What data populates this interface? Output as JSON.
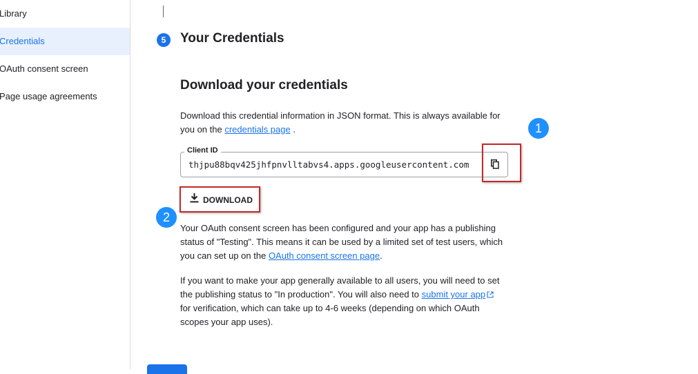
{
  "sidebar": {
    "items": [
      {
        "label": "Library"
      },
      {
        "label": "Credentials",
        "active": true
      },
      {
        "label": "OAuth consent screen"
      },
      {
        "label": "Page usage agreements"
      }
    ]
  },
  "step": {
    "number": "5",
    "title": "Your Credentials"
  },
  "download_section": {
    "title": "Download your credentials",
    "intro_line1": "Download this credential information in JSON format. This is always available for",
    "intro_line2_prefix": "you on the ",
    "intro_link": "credentials page",
    "intro_line2_suffix": " .",
    "client_id_label": "Client ID",
    "client_id_value": "thjpu88bqv425jhfpnvlltabvs4.apps.googleusercontent.com",
    "copy_icon": "copy-icon",
    "download_label": "DOWNLOAD",
    "download_icon": "download-icon"
  },
  "consent_paragraph": {
    "line1": "Your OAuth consent screen has been configured and your app has a publishing",
    "line2": "status of \"Testing\". This means it can be used by a limited set of test users, which",
    "line3_prefix": "you can set up on the ",
    "line3_link": "OAuth consent screen page",
    "line3_suffix": "."
  },
  "publish_paragraph": {
    "line1": "If you want to make your app generally available to all users, you will need to set",
    "line2_prefix": "the publishing status to \"In production\". You will also need to ",
    "line2_link": "submit your app",
    "line3": "for verification, which can take up to 4-6 weeks (depending on which OAuth",
    "line4": "scopes your app uses)."
  },
  "annotations": {
    "callout_1": "1",
    "callout_2": "2"
  },
  "colors": {
    "accent": "#1a73e8",
    "highlight_border": "#c62828",
    "callout": "#1e90ff",
    "active_nav_bg": "#e8f0fe"
  }
}
